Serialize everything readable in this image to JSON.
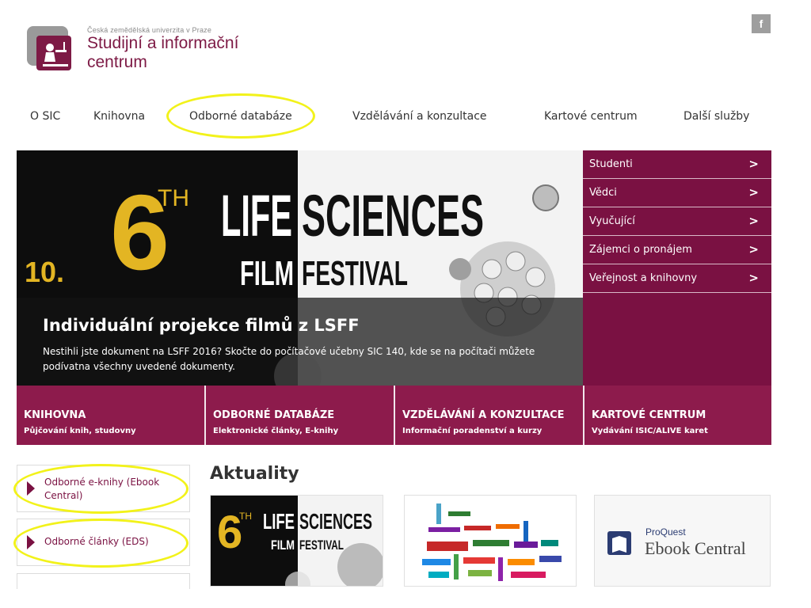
{
  "header": {
    "university": "Česká zemědělská univerzita v Praze",
    "title_line1": "Studijní a informační",
    "title_line2": "centrum",
    "facebook_label": "f"
  },
  "nav": [
    "O SIC",
    "Knihovna",
    "Odborné databáze",
    "Vzdělávání a konzultace",
    "Kartové centrum",
    "Další služby"
  ],
  "hero": {
    "number": "6",
    "number_suffix": "TH",
    "edition": "10.",
    "banner_words": [
      "LIFE",
      "SCIENCES",
      "FILM",
      "FESTIVAL"
    ],
    "title": "Individuální projekce filmů z LSFF",
    "description": "Nestihli jste dokument na LSFF 2016? Skočte do počítačové učebny SIC 140, kde se na počítači můžete podívatna všechny uvedené dokumenty."
  },
  "audience_menu": [
    "Studenti",
    "Vědci",
    "Vyučující",
    "Zájemci o pronájem",
    "Veřejnost a knihovny"
  ],
  "tiles": [
    {
      "title": "KNIHOVNA",
      "subtitle": "Půjčování knih, studovny"
    },
    {
      "title": "ODBORNÉ DATABÁZE",
      "subtitle": "Elektronické články, E-knihy"
    },
    {
      "title": "VZDĚLÁVÁNÍ A KONZULTACE",
      "subtitle": "Informační poradenství a kurzy"
    },
    {
      "title": "KARTOVÉ CENTRUM",
      "subtitle": "Vydávání ISIC/ALIVE karet"
    }
  ],
  "quick_links": [
    "Odborné e-knihy (Ebook Central)",
    "Odborné články (EDS)"
  ],
  "news": {
    "heading": "Aktuality",
    "card3_brand_small": "ProQuest",
    "card3_brand_big": "Ebook Central"
  },
  "colors": {
    "accent": "#7a1142",
    "tile": "#8d1b4c",
    "highlight": "#f2f21a"
  }
}
